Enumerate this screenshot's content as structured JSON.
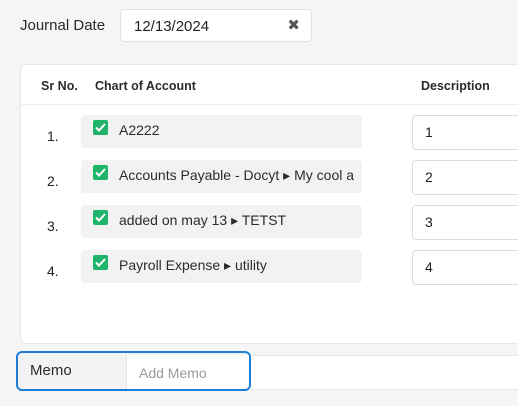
{
  "journal_date": {
    "label": "Journal Date",
    "value": "12/13/2024",
    "clear_glyph": "✖"
  },
  "table": {
    "headers": {
      "sr_no": "Sr No.",
      "chart_of_account": "Chart of Account",
      "description": "Description"
    },
    "rows": [
      {
        "num": "1.",
        "account": "A2222",
        "checked": true,
        "description": "1"
      },
      {
        "num": "2.",
        "account": "Accounts Payable - Docyt ▸ My cool a",
        "checked": true,
        "description": "2"
      },
      {
        "num": "3.",
        "account": "added on may 13 ▸ TETST",
        "checked": true,
        "description": "3"
      },
      {
        "num": "4.",
        "account": "Payroll Expense ▸ utility",
        "checked": true,
        "description": "4"
      }
    ]
  },
  "memo": {
    "label": "Memo",
    "placeholder": "Add Memo",
    "value": ""
  },
  "colors": {
    "check_green": "#1fb46b",
    "focus_blue": "#1d7fd4",
    "account_chip_bg": "#f3f2f3"
  },
  "icons": {
    "clear": "close-x-icon",
    "check": "checkbox-checked-icon"
  }
}
